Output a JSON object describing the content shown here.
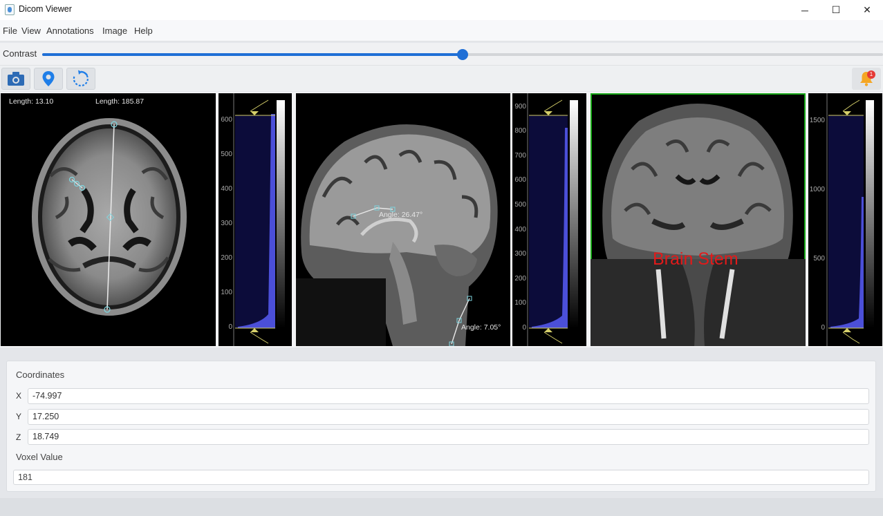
{
  "window": {
    "title": "Dicom Viewer",
    "minimize": "─",
    "maximize": "☐",
    "close": "✕"
  },
  "menu": [
    "File",
    "View",
    "Annotations",
    "Image",
    "Help"
  ],
  "contrast": {
    "label": "Contrast",
    "value_fraction": 0.5
  },
  "toolbar": {
    "tools": [
      "camera-icon",
      "map-pin-icon",
      "rotate-icon"
    ],
    "notifications": {
      "icon": "bell-icon",
      "badge": "1"
    }
  },
  "viewers": {
    "axial": {
      "length_1": "Length: 13.10",
      "length_2": "Length: 185.87",
      "ticks": [
        "600",
        "500",
        "400",
        "300",
        "200",
        "100",
        "0"
      ]
    },
    "sagittal": {
      "angle_1": "Angle: 26.47°",
      "angle_2": "Angle: 7.05°",
      "ticks": [
        "900",
        "800",
        "700",
        "600",
        "500",
        "400",
        "300",
        "200",
        "100",
        "0"
      ]
    },
    "coronal": {
      "label": "Brain Stem",
      "ticks": [
        "1500",
        "1000",
        "500",
        "0"
      ]
    }
  },
  "coordinates": {
    "title": "Coordinates",
    "x_label": "X",
    "x_value": "-74.997",
    "y_label": "Y",
    "y_value": "17.250",
    "z_label": "Z",
    "z_value": "18.749",
    "voxel_label": "Voxel Value",
    "voxel_value": "181"
  },
  "colors": {
    "accent": "#1f6fd6",
    "active_border": "#18a818",
    "annotation": "#7fd6e0",
    "label": "#e21a1a",
    "histogram": "#4b4fd8"
  }
}
